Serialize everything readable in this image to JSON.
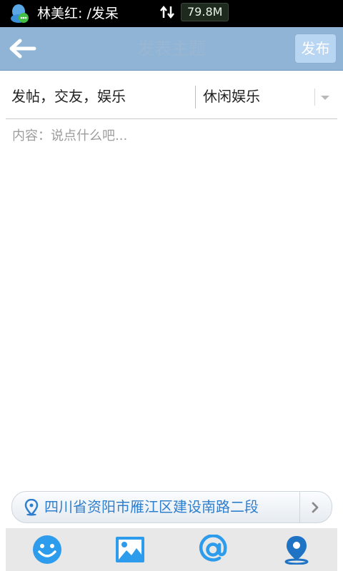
{
  "status_bar": {
    "notification_text": "林美红: /发呆",
    "net_speed": "79.8M"
  },
  "header": {
    "title": "发表主题",
    "publish_label": "发布"
  },
  "form": {
    "subject_value": "发帖，交友，娱乐",
    "category_value": "休闲娱乐",
    "content_placeholder": "内容：说点什么吧..."
  },
  "location": {
    "address": "四川省资阳市雁江区建设南路二段"
  },
  "toolbar": {
    "icons": [
      "emoji-icon",
      "image-icon",
      "at-icon",
      "location-icon"
    ]
  },
  "colors": {
    "accent": "#1e88e5",
    "title_bar": "#8fb4d6",
    "publish_button": "#b8d5f1",
    "location_text": "#2f7fcf"
  }
}
